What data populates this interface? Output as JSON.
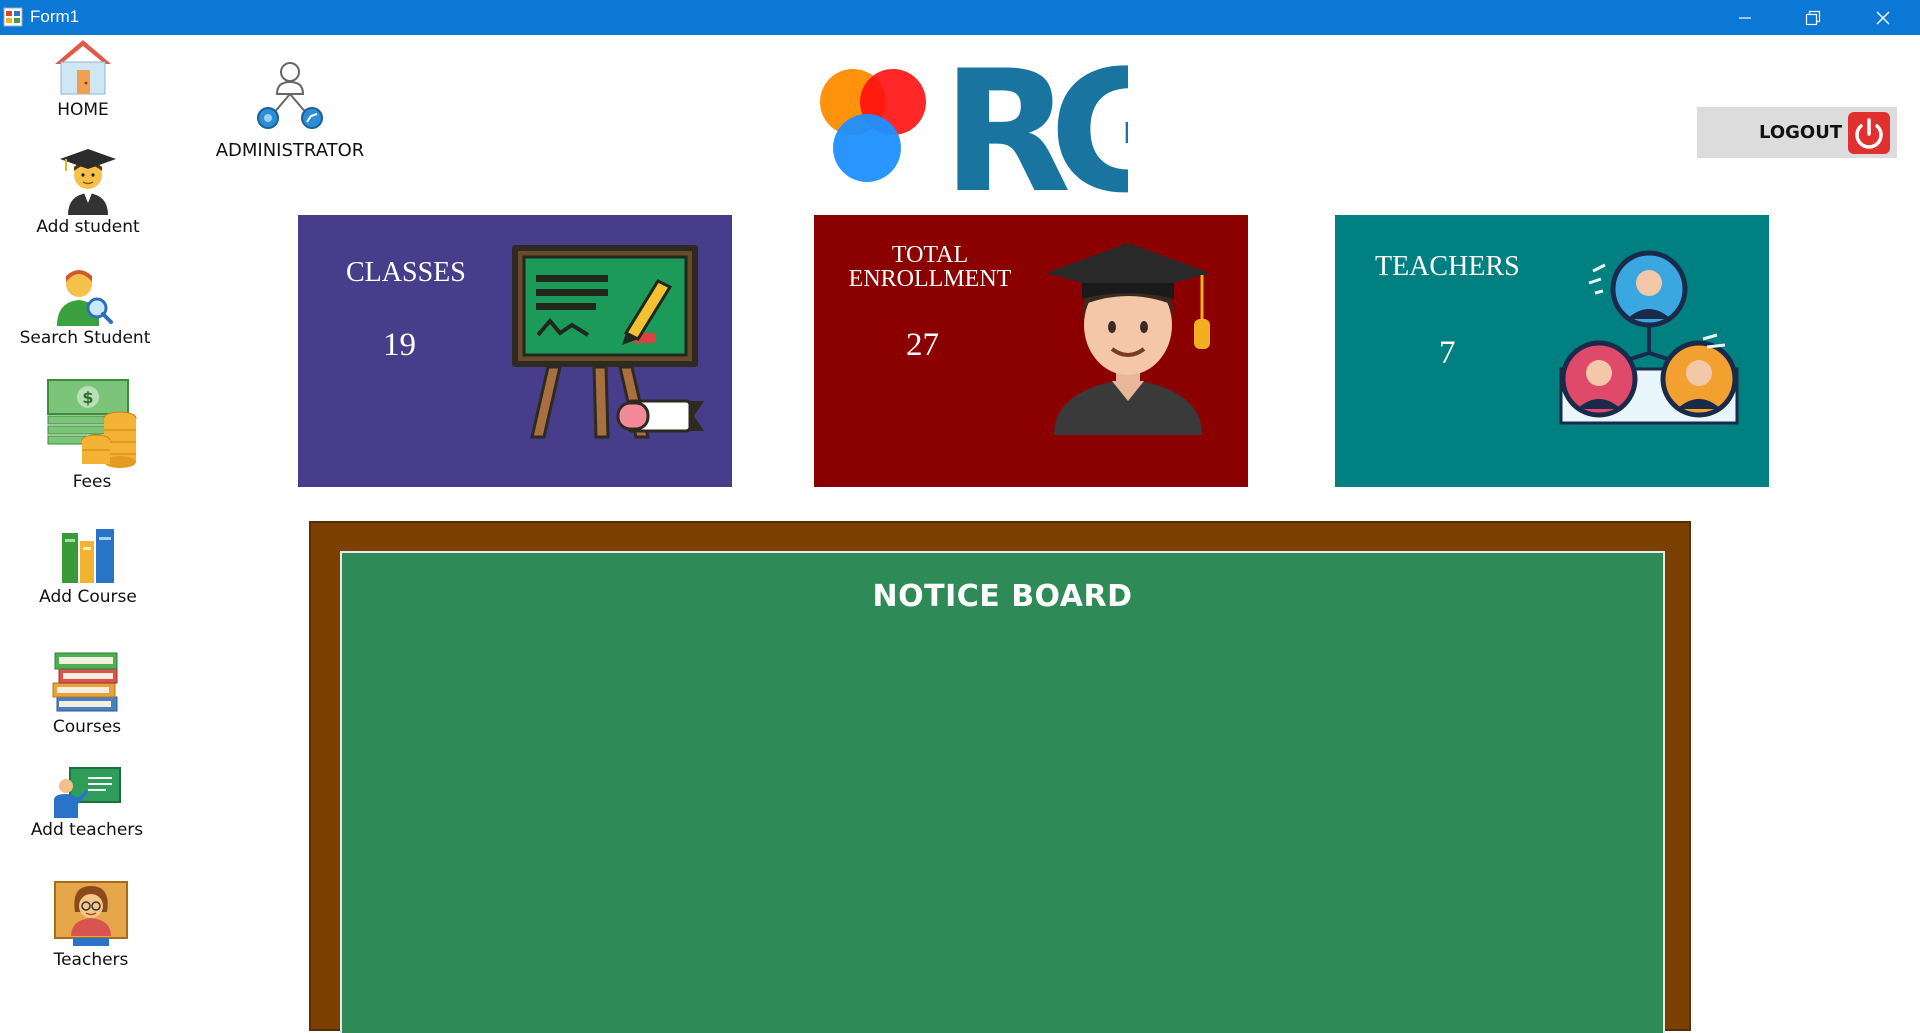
{
  "window": {
    "title": "Form1",
    "bar_color": "#0a78d4"
  },
  "sidebar": {
    "items": [
      {
        "label": "HOME",
        "icon": "house-icon"
      },
      {
        "label": "Add student",
        "icon": "graduate-student-icon"
      },
      {
        "label": "Search Student",
        "icon": "search-person-icon"
      },
      {
        "label": "Fees",
        "icon": "money-coins-icon"
      },
      {
        "label": "Add Course",
        "icon": "books-shelf-icon"
      },
      {
        "label": "Courses",
        "icon": "book-stack-icon"
      },
      {
        "label": "Add teachers",
        "icon": "teacher-board-icon"
      },
      {
        "label": "Teachers",
        "icon": "teacher-avatar-icon"
      }
    ]
  },
  "header": {
    "admin_label": "ADMINISTRATOR",
    "logo_text": "RG",
    "logout_label": "LOGOUT"
  },
  "cards": [
    {
      "title": "CLASSES",
      "value": "19",
      "color": "#483d8b",
      "icon": "chalkboard-easel-icon"
    },
    {
      "title_line1": "TOTAL",
      "title_line2": "ENROLLMENT",
      "value": "27",
      "color": "#8b0000",
      "icon": "graduate-icon"
    },
    {
      "title": "TEACHERS",
      "value": "7",
      "color": "#008080",
      "icon": "team-network-icon"
    }
  ],
  "notice_board": {
    "title": "NOTICE BOARD",
    "frame_color": "#7b3f00",
    "board_color": "#2e8b57"
  }
}
